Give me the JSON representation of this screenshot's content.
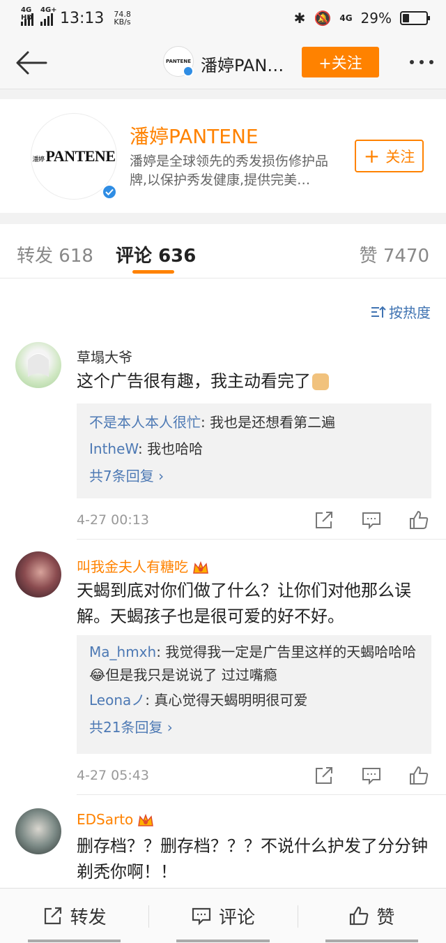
{
  "status_bar": {
    "network1": "4G HD",
    "network2": "4G+",
    "time": "13:13",
    "speed_value": "74.8",
    "speed_unit": "KB/s",
    "network3": "4G",
    "battery": "29%"
  },
  "nav": {
    "title": "潘婷PAN…",
    "follow_label": "+关注",
    "avatar_brand": "PANTENE"
  },
  "profile": {
    "avatar_brand_cn": "潘婷",
    "avatar_brand": "PANTENE",
    "name": "潘婷PANTENE",
    "description": "潘婷是全球领先的秀发损伤修护品牌,以保护秀发健康,提供完美…",
    "follow_label": "关注"
  },
  "tabs": {
    "repost_label": "转发",
    "repost_count": "618",
    "comment_label": "评论",
    "comment_count": "636",
    "like_label": "赞",
    "like_count": "7470"
  },
  "sort_label": "按热度",
  "comments": [
    {
      "name": "草塌大爷",
      "text": "这个广告很有趣，我主动看完了",
      "replies": [
        {
          "name": "不是本人本人很忙",
          "text": ": 我也是还想看第二遍"
        },
        {
          "name": "IntheW",
          "text": ": 我也哈哈"
        }
      ],
      "more": "共7条回复 ›",
      "time": "4-27 00:13"
    },
    {
      "name": "叫我金夫人有糖吃",
      "text": "天蝎到底对你们做了什么？让你们对他那么误解。天蝎孩子也是很可爱的好不好。",
      "replies": [
        {
          "name": "Ma_hmxh",
          "text": ": 我觉得我一定是广告里这样的天蝎哈哈哈😂但是我只是说说了 过过嘴瘾"
        },
        {
          "name": "Leonaノ",
          "text": ": 真心觉得天蝎明明很可爱"
        }
      ],
      "more": "共21条回复 ›",
      "time": "4-27 05:43"
    },
    {
      "name": "EDSarto",
      "text": "删存档？？删存档？？？不说什么护发了分分钟剃秃你啊！！"
    }
  ],
  "toolbar": {
    "repost": "转发",
    "comment": "评论",
    "like": "赞"
  },
  "colors": {
    "accent": "#ff8200",
    "link": "#4d79b4",
    "verified": "#2f8de4"
  }
}
